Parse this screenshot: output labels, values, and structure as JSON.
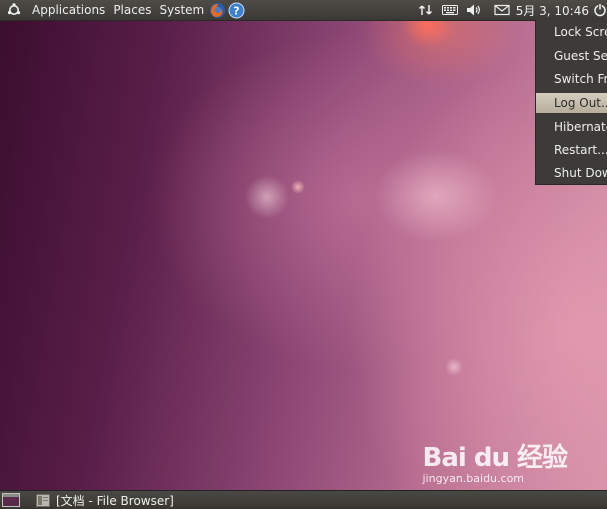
{
  "top_panel": {
    "menus": [
      "Applications",
      "Places",
      "System"
    ],
    "clock": "5月 3, 10:46"
  },
  "session_menu": {
    "items": [
      "Lock Screen",
      "Guest Session...",
      "Switch From...",
      "Log Out...",
      "Hibernate",
      "Restart...",
      "Shut Down..."
    ],
    "selected": "Log Out..."
  },
  "bottom_panel": {
    "window_title": "[文档 - File Browser]"
  },
  "watermark": {
    "brand": "Bai du 经验",
    "url": "jingyan.baidu.com"
  },
  "colors": {
    "panel": "#3c3b37",
    "selection": "#c9c1b0",
    "wallpaper_accent": "#8a4573"
  }
}
